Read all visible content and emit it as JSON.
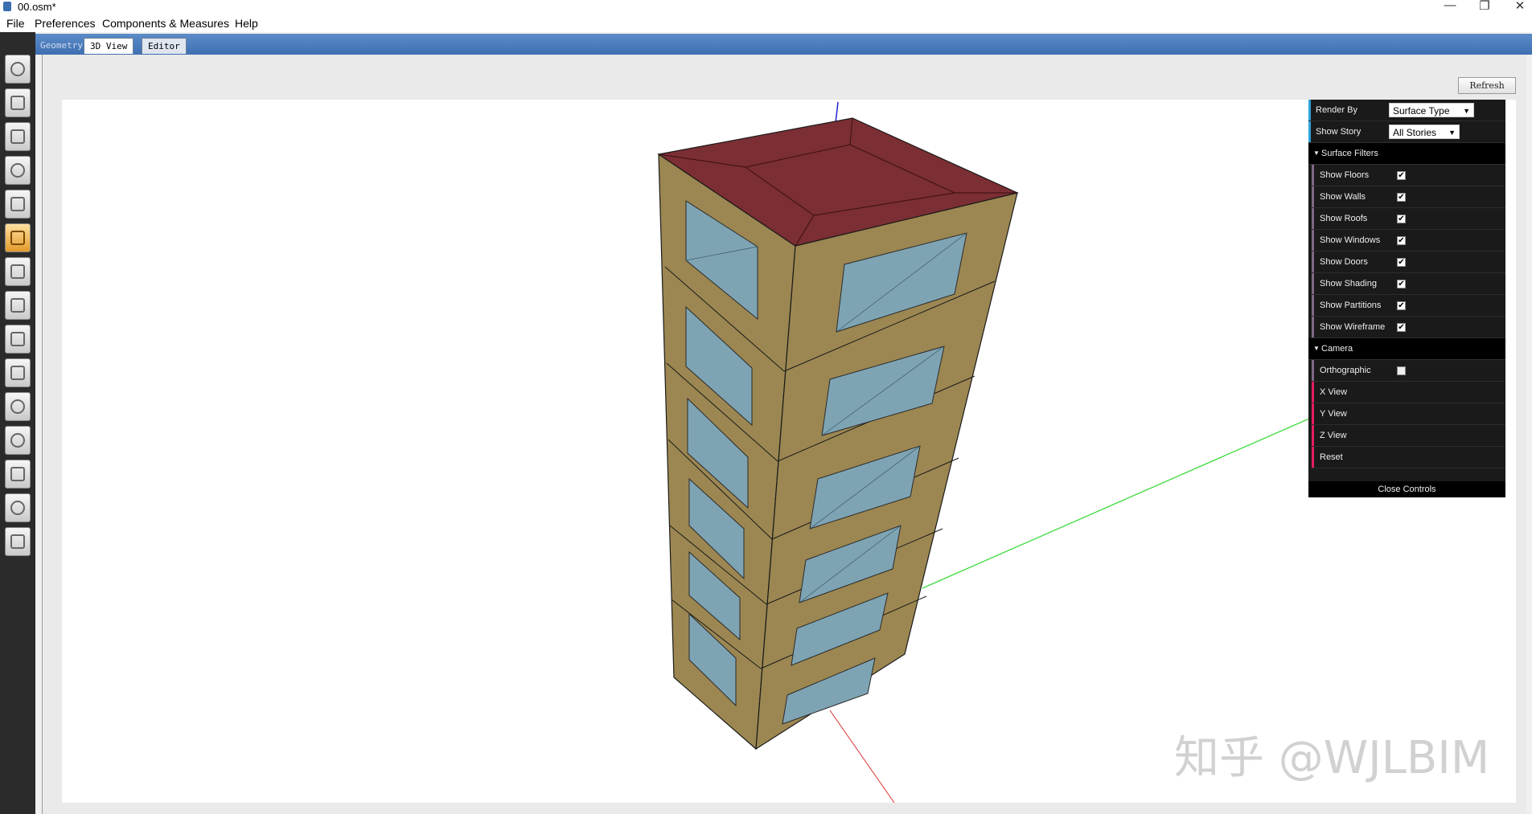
{
  "window": {
    "title": "00.osm*",
    "minimize": "—",
    "restore": "❐",
    "close": "✕"
  },
  "menu": [
    "File",
    "Preferences",
    "Components & Measures",
    "Help"
  ],
  "toolbar_icons": [
    "site-icon",
    "schedules-icon",
    "constructions-icon",
    "loads-icon",
    "space-types-icon",
    "geometry-icon",
    "facility-icon",
    "spaces-icon",
    "thermal-zones-icon",
    "hvac-systems-icon",
    "building-summary-icon",
    "measures-icon",
    "simulation-settings-icon",
    "run-simulation-icon",
    "results-summary-icon"
  ],
  "tabs": {
    "group": "Geometry",
    "view3d": "3D View",
    "editor": "Editor"
  },
  "refresh_label": "Refresh",
  "controls": {
    "render_by": {
      "label": "Render By",
      "value": "Surface Type"
    },
    "show_story": {
      "label": "Show Story",
      "value": "All Stories"
    },
    "surface_filters": {
      "title": "Surface Filters",
      "items": [
        {
          "label": "Show Floors",
          "checked": "✔"
        },
        {
          "label": "Show Walls",
          "checked": "✔"
        },
        {
          "label": "Show Roofs",
          "checked": "✔"
        },
        {
          "label": "Show Windows",
          "checked": "✔"
        },
        {
          "label": "Show Doors",
          "checked": "✔"
        },
        {
          "label": "Show Shading",
          "checked": "✔"
        },
        {
          "label": "Show Partitions",
          "checked": "✔"
        },
        {
          "label": "Show Wireframe",
          "checked": "✔"
        }
      ]
    },
    "camera": {
      "title": "Camera",
      "orthographic": "Orthographic",
      "buttons": [
        "X View",
        "Y View",
        "Z View",
        "Reset"
      ]
    },
    "close_label": "Close Controls"
  },
  "watermark": "知乎 @WJLBIM",
  "colors": {
    "wall": "#9c8752",
    "roof": "#7b2e33",
    "window": "#7ea4b4",
    "accent": "#3e6fb1"
  }
}
